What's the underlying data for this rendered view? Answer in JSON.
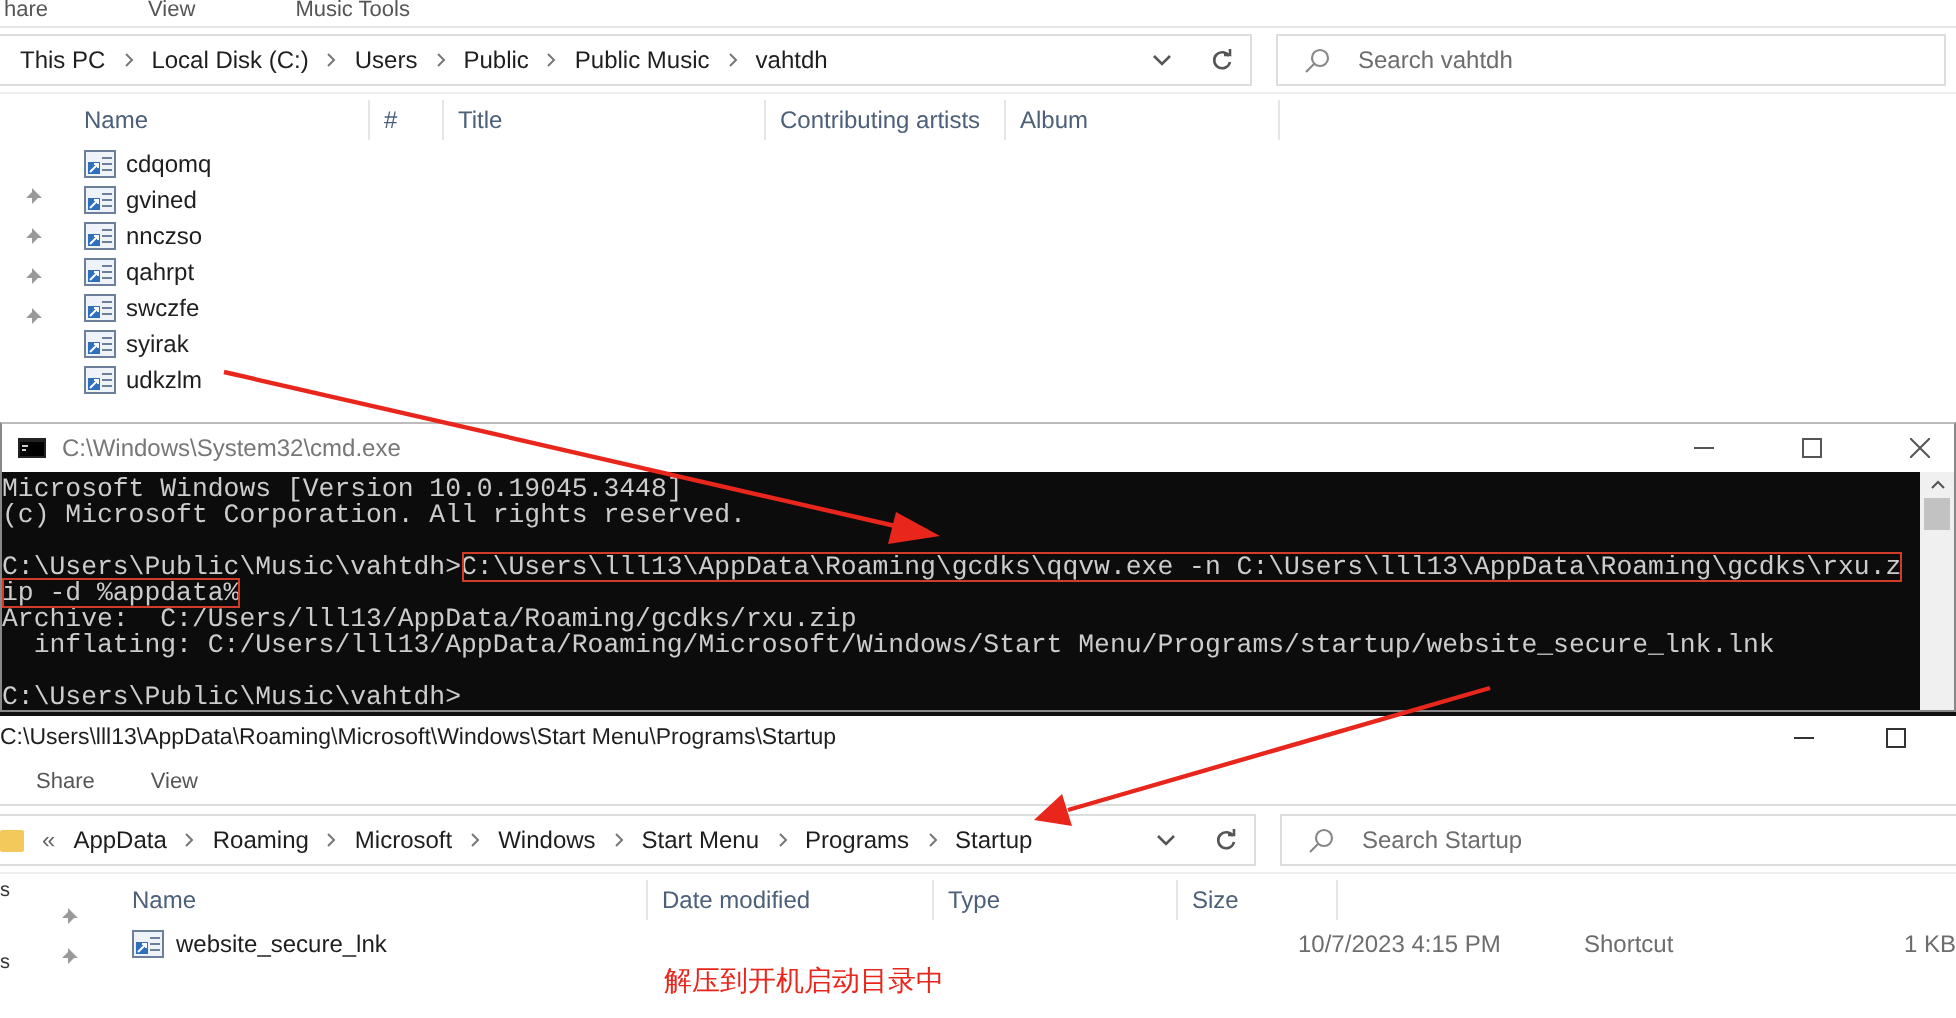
{
  "music_explorer": {
    "ribbon_tabs": [
      "hare",
      "View",
      "Music Tools"
    ],
    "breadcrumb": [
      "This PC",
      "Local Disk (C:)",
      "Users",
      "Public",
      "Public Music",
      "vahtdh"
    ],
    "search": {
      "placeholder": "Search vahtdh"
    },
    "columns": [
      "Name",
      "#",
      "Title",
      "Contributing artists",
      "Album"
    ],
    "files": [
      "cdqomq",
      "gvined",
      "nnczso",
      "qahrpt",
      "swczfe",
      "syirak",
      "udkzlm"
    ]
  },
  "cmd": {
    "title": "C:\\Windows\\System32\\cmd.exe",
    "blocks": [
      [
        [
          {
            "text": "Microsoft Windows [Version 10.0.19045.3448]",
            "highlighted": false
          }
        ],
        [
          {
            "text": "(c) Microsoft Corporation. All rights reserved.",
            "highlighted": false
          }
        ]
      ],
      [
        [
          {
            "text": "C:\\Users\\Public\\Music\\vahtdh>",
            "highlighted": false
          },
          {
            "text": "C:\\Users\\lll13\\AppData\\Roaming\\gcdks\\qqvw.exe -n C:\\Users\\lll13\\AppData\\Roaming\\gcdks\\rxu.z",
            "highlighted": true
          }
        ],
        [
          {
            "text": "ip -d %appdata%",
            "highlighted": true
          }
        ],
        [
          {
            "text": "Archive:  C:/Users/lll13/AppData/Roaming/gcdks/rxu.zip",
            "highlighted": false
          }
        ],
        [
          {
            "text": "  inflating: C:/Users/lll13/AppData/Roaming/Microsoft/Windows/Start Menu/Programs/startup/website_secure_lnk.lnk",
            "highlighted": false
          }
        ]
      ],
      [
        [
          {
            "text": "C:\\Users\\Public\\Music\\vahtdh>",
            "highlighted": false
          }
        ]
      ]
    ]
  },
  "startup_explorer": {
    "title": "C:\\Users\\lll13\\AppData\\Roaming\\Microsoft\\Windows\\Start Menu\\Programs\\Startup",
    "ribbon_tabs": [
      "Share",
      "View"
    ],
    "breadcrumb_overflow": "«",
    "breadcrumb": [
      "AppData",
      "Roaming",
      "Microsoft",
      "Windows",
      "Start Menu",
      "Programs",
      "Startup"
    ],
    "search": {
      "placeholder": "Search Startup"
    },
    "nav_labels": [
      "s",
      "s"
    ],
    "columns": [
      "Name",
      "Date modified",
      "Type",
      "Size"
    ],
    "files": [
      {
        "name": "website_secure_lnk",
        "date": "10/7/2023 4:15 PM",
        "type": "Shortcut",
        "size": "1 KB"
      }
    ]
  },
  "annotation": "解压到开机启动目录中"
}
